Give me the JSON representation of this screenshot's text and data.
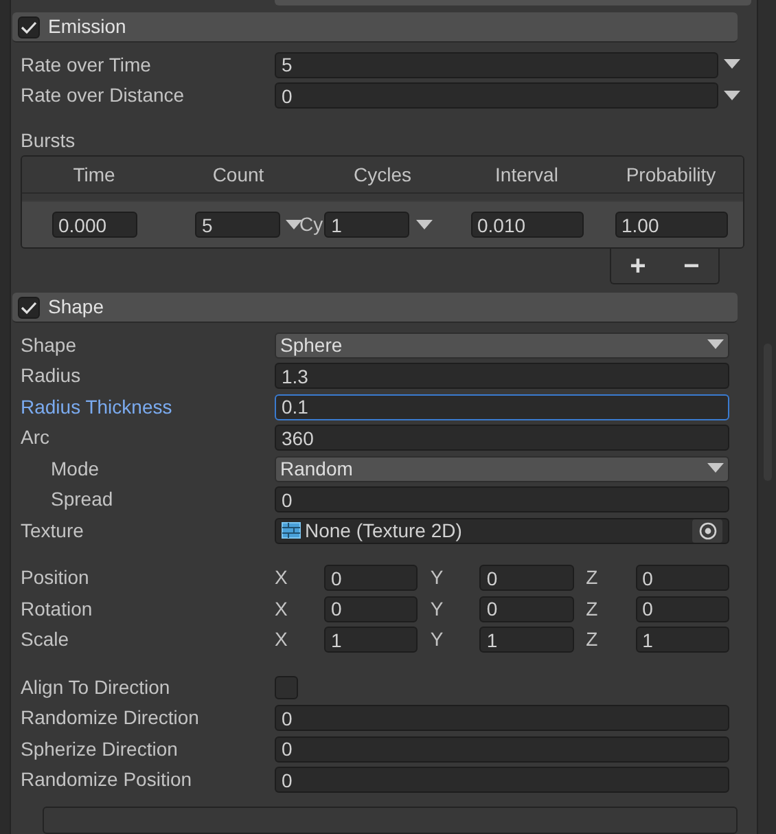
{
  "emission": {
    "title": "Emission",
    "enabled": true,
    "fields": [
      {
        "label": "Rate over Time",
        "value": "5",
        "kind": "curve"
      },
      {
        "label": "Rate over Distance",
        "value": "0",
        "kind": "curve"
      }
    ],
    "bursts": {
      "label": "Bursts",
      "columns": [
        "Time",
        "Count",
        "Cycles",
        "Interval",
        "Probability"
      ],
      "rows": [
        {
          "time": "0.000",
          "count": "5",
          "cycles_prefix": "Cy",
          "cycles": "1",
          "interval": "0.010",
          "probability": "1.00"
        }
      ],
      "add_button": "+",
      "remove_button": "−"
    }
  },
  "shape": {
    "title": "Shape",
    "enabled": true,
    "groups": [
      [
        {
          "label": "Shape",
          "kind": "dropdown",
          "value": "Sphere",
          "focused": false
        },
        {
          "label": "Radius",
          "kind": "number",
          "value": "1.3",
          "focused": false
        },
        {
          "label": "Radius Thickness",
          "kind": "number",
          "value": "0.1",
          "focused": true
        },
        {
          "label": "Arc",
          "kind": "number",
          "value": "360",
          "focused": false,
          "children": [
            {
              "label": "Mode",
              "kind": "dropdown",
              "value": "Random",
              "focused": false
            },
            {
              "label": "Spread",
              "kind": "number",
              "value": "0",
              "focused": false
            }
          ]
        },
        {
          "label": "Texture",
          "kind": "object",
          "value": "None (Texture 2D)",
          "focused": false
        }
      ],
      [
        {
          "label": "Position",
          "kind": "vector3",
          "axes": [
            {
              "axis": "X",
              "value": "0"
            },
            {
              "axis": "Y",
              "value": "0"
            },
            {
              "axis": "Z",
              "value": "0"
            }
          ]
        },
        {
          "label": "Rotation",
          "kind": "vector3",
          "axes": [
            {
              "axis": "X",
              "value": "0"
            },
            {
              "axis": "Y",
              "value": "0"
            },
            {
              "axis": "Z",
              "value": "0"
            }
          ]
        },
        {
          "label": "Scale",
          "kind": "vector3",
          "axes": [
            {
              "axis": "X",
              "value": "1"
            },
            {
              "axis": "Y",
              "value": "1"
            },
            {
              "axis": "Z",
              "value": "1"
            }
          ]
        }
      ],
      [
        {
          "label": "Align To Direction",
          "kind": "checkbox",
          "checked": false
        },
        {
          "label": "Randomize Direction",
          "kind": "number",
          "value": "0",
          "focused": false
        },
        {
          "label": "Spherize Direction",
          "kind": "number",
          "value": "0",
          "focused": false
        },
        {
          "label": "Randomize Position",
          "kind": "number",
          "value": "0",
          "focused": false
        }
      ]
    ]
  }
}
